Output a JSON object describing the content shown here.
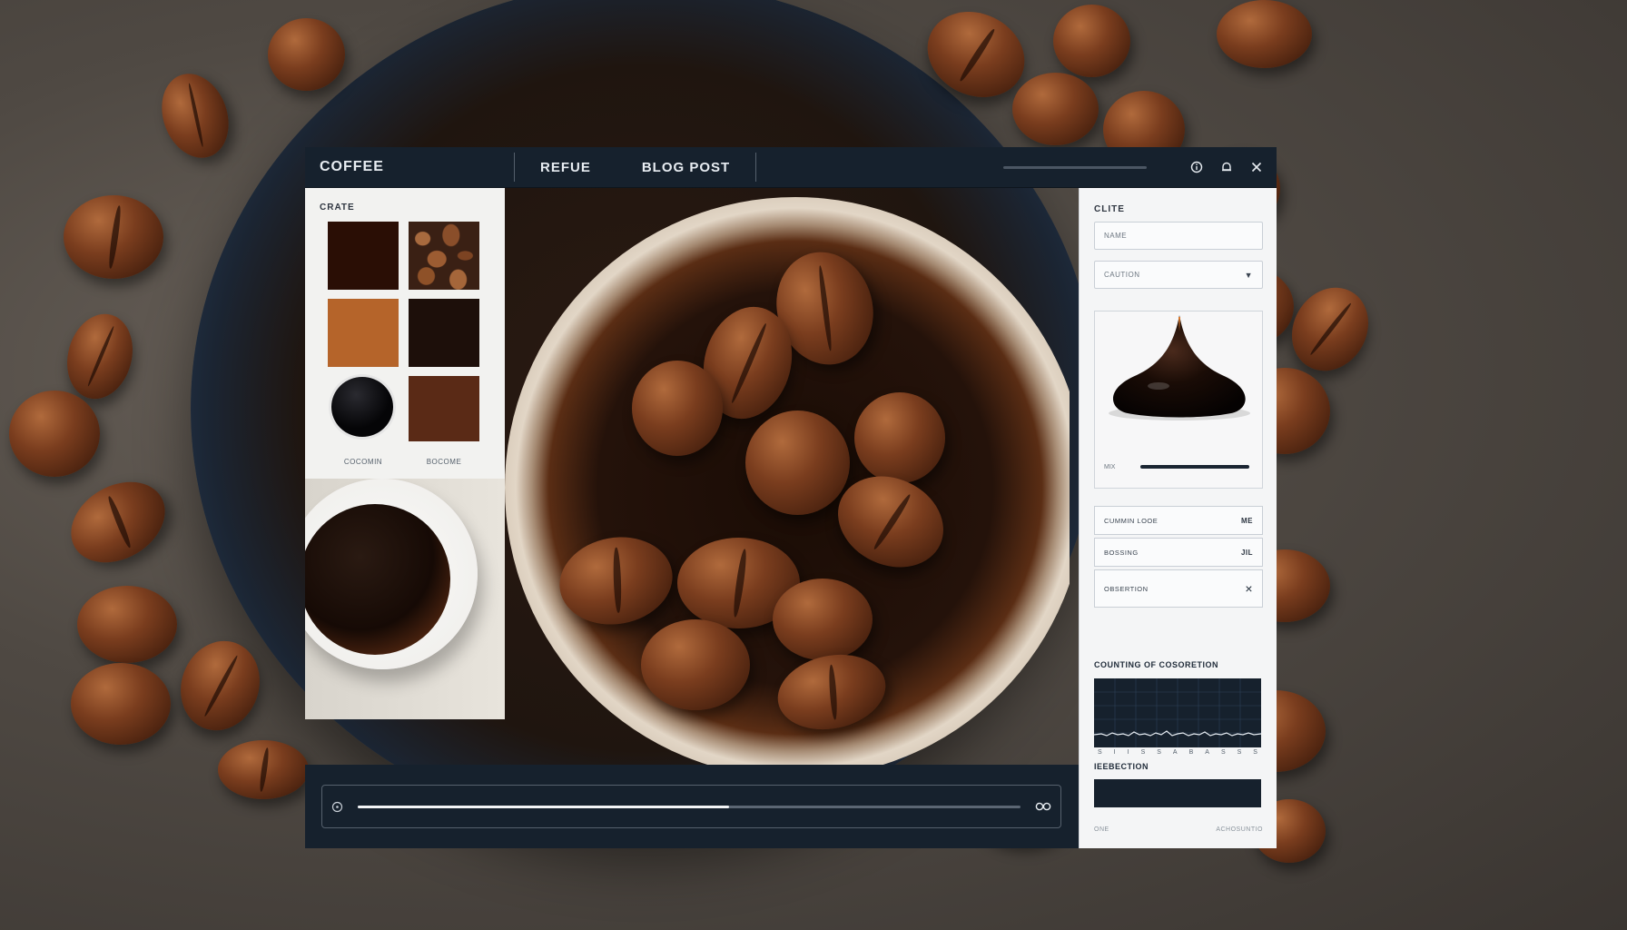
{
  "window": {
    "app_title": "COFFEE",
    "tabs": [
      {
        "label": "REFUE"
      },
      {
        "label": "BLOG POST"
      }
    ]
  },
  "left_panel": {
    "heading": "CRATE",
    "swatches": [
      {
        "color": "#2a0e05"
      },
      {
        "color": "beans-photo"
      },
      {
        "color": "#b5642a"
      },
      {
        "color": "#1d0f0a"
      },
      {
        "color": "#050507"
      },
      {
        "color": "#5a2a16"
      }
    ],
    "labels": [
      "COCOMIN",
      "BOCOME"
    ]
  },
  "right_panel": {
    "heading": "CLITE",
    "name_field": "NAME",
    "select_field": "CAUTION",
    "slider_label": "MIX",
    "rows": [
      {
        "label": "CUMMIN LOOE",
        "value": "ME"
      },
      {
        "label": "BOSSING",
        "value": "JIL"
      },
      {
        "label": "OBSERTION",
        "value": "×"
      }
    ],
    "chart_section_title": "COUNTING OF COSORETION",
    "chart_ticks": [
      "S",
      "I",
      "I",
      "S",
      "S",
      "A",
      "B",
      "A",
      "S",
      "S",
      "S"
    ],
    "bottom_section_title": "IEEBECTION",
    "footer_left": "ONE",
    "footer_right": "ACHOSUNTIO"
  },
  "player": {
    "progress": 0.56
  },
  "colors": {
    "chrome": "#16212d",
    "panel": "#f4f5f6",
    "accent": "#f2f4f6"
  },
  "icons": [
    "play-icon",
    "loop-icon",
    "info-icon",
    "bell-icon",
    "close-icon",
    "chevron-down-icon",
    "close-x-icon"
  ]
}
